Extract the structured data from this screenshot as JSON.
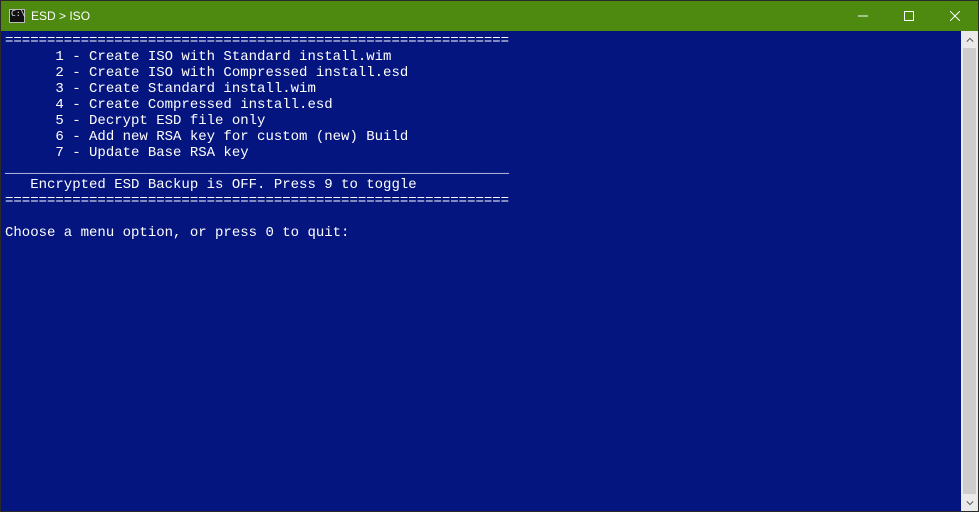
{
  "window": {
    "title": "ESD > ISO"
  },
  "terminal": {
    "divider_top": "============================================================",
    "divider_short": "____________________________________________________________",
    "divider_bottom": "============================================================",
    "menu": [
      {
        "num": "1",
        "label": "Create ISO with Standard install.wim"
      },
      {
        "num": "2",
        "label": "Create ISO with Compressed install.esd"
      },
      {
        "num": "3",
        "label": "Create Standard install.wim"
      },
      {
        "num": "4",
        "label": "Create Compressed install.esd"
      },
      {
        "num": "5",
        "label": "Decrypt ESD file only"
      },
      {
        "num": "6",
        "label": "Add new RSA key for custom (new) Build"
      },
      {
        "num": "7",
        "label": "Update Base RSA key"
      }
    ],
    "status": "   Encrypted ESD Backup is OFF. Press 9 to toggle",
    "prompt": "Choose a menu option, or press 0 to quit:"
  }
}
